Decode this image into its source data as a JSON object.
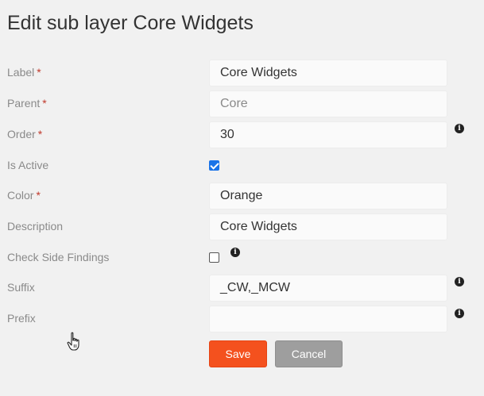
{
  "page": {
    "title": "Edit sub layer Core Widgets"
  },
  "required_marker": "*",
  "info_glyph": "i",
  "fields": {
    "label": {
      "label": "Label",
      "value": "Core Widgets"
    },
    "parent": {
      "label": "Parent",
      "value": "Core"
    },
    "order": {
      "label": "Order",
      "value": "30"
    },
    "is_active": {
      "label": "Is Active",
      "checked": true
    },
    "color": {
      "label": "Color",
      "value": "Orange"
    },
    "description": {
      "label": "Description",
      "value": "Core Widgets"
    },
    "check_side_findings": {
      "label": "Check Side Findings",
      "checked": false
    },
    "suffix": {
      "label": "Suffix",
      "value": "_CW,_MCW"
    },
    "prefix": {
      "label": "Prefix",
      "value": ""
    }
  },
  "actions": {
    "save_label": "Save",
    "cancel_label": "Cancel"
  },
  "colors": {
    "save": "#f4511e",
    "cancel": "#9e9e9e",
    "required": "#c0392b",
    "checkbox": "#1a73e8"
  },
  "icons": {
    "info": "info-circle-icon",
    "cursor": "hand-pointer-icon"
  }
}
